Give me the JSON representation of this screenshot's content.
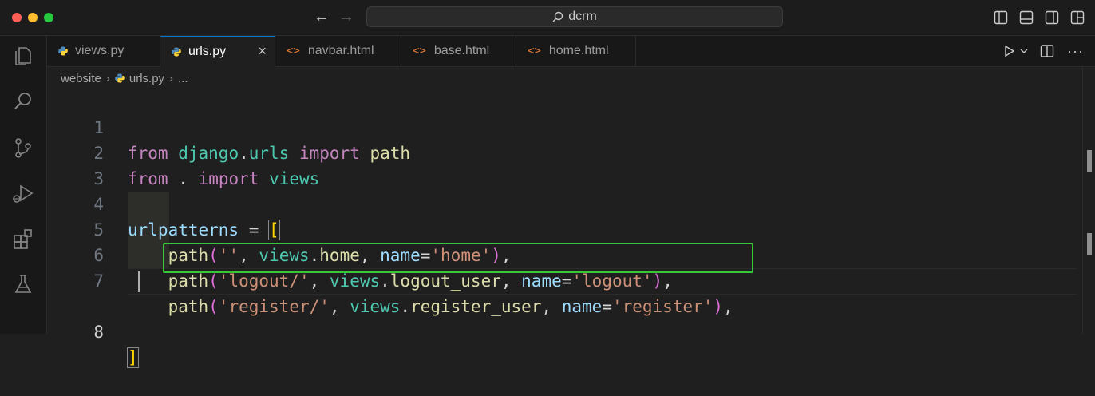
{
  "titlebar": {
    "search_text": "dcrm",
    "colors": {
      "close": "#ff5f57",
      "minimize": "#febc2e",
      "maximize": "#28c840"
    }
  },
  "activity_bar": {
    "icons": [
      "files-icon",
      "search-icon",
      "source-control-icon",
      "run-debug-icon",
      "extensions-icon",
      "testing-icon"
    ]
  },
  "tabs": [
    {
      "label": "views.py",
      "icon": "python-icon",
      "active": false
    },
    {
      "label": "urls.py",
      "icon": "python-icon",
      "active": true,
      "close": "×"
    },
    {
      "label": "navbar.html",
      "icon": "html-icon",
      "active": false
    },
    {
      "label": "base.html",
      "icon": "html-icon",
      "active": false
    },
    {
      "label": "home.html",
      "icon": "html-icon",
      "active": false
    }
  ],
  "breadcrumb": {
    "folder": "website",
    "file": "urls.py",
    "more": "..."
  },
  "editor": {
    "line_numbers": [
      "1",
      "2",
      "3",
      "4",
      "5",
      "6",
      "7",
      "8"
    ],
    "active_line": "8",
    "tokens": {
      "l1": [
        "from",
        "django",
        ".",
        "urls",
        "import",
        "path"
      ],
      "l2": [
        "from",
        ".",
        "import",
        "views"
      ],
      "l4": [
        "urlpatterns",
        "=",
        "["
      ],
      "l5": [
        "path",
        "(",
        "''",
        ", ",
        "views",
        ".",
        "home",
        ", ",
        "name",
        "=",
        "'home'",
        ")",
        ","
      ],
      "l6": [
        "path",
        "(",
        "'logout/'",
        ", ",
        "views",
        ".",
        "logout_user",
        ", ",
        "name",
        "=",
        "'logout'",
        ")",
        ","
      ],
      "l7": [
        "path",
        "(",
        "'register/'",
        ", ",
        "views",
        ".",
        "register_user",
        ", ",
        "name",
        "=",
        "'register'",
        ")",
        ","
      ],
      "l8": [
        "]"
      ]
    },
    "highlight_color": "#37c837"
  },
  "tab_html_glyph": "<>"
}
